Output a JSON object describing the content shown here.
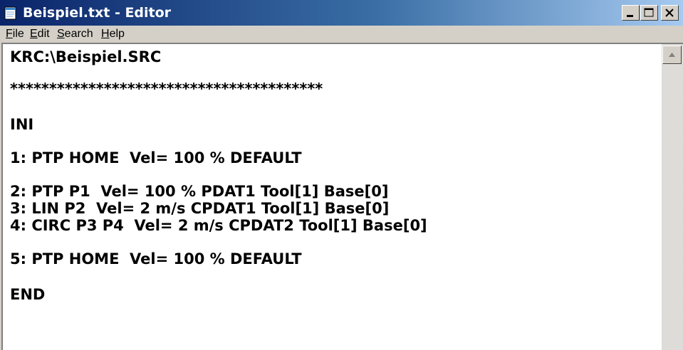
{
  "window": {
    "title": "Beispiel.txt - Editor",
    "app_icon": "notepad-icon",
    "caption_buttons": [
      "minimize-icon",
      "maximize-icon",
      "close-icon"
    ]
  },
  "menubar": {
    "items": [
      {
        "label_first": "F",
        "label_rest": "ile"
      },
      {
        "label_first": "E",
        "label_rest": "dit"
      },
      {
        "label_first": "S",
        "label_rest": "earch"
      },
      {
        "label_first": "H",
        "label_rest": "elp"
      }
    ]
  },
  "editor": {
    "lines": [
      "KRC:\\Beispiel.SRC",
      "****************************************",
      "INI",
      "1: PTP HOME  Vel= 100 % DEFAULT",
      "2: PTP P1  Vel= 100 % PDAT1 Tool[1] Base[0]",
      "3: LIN P2  Vel= 2 m/s CPDAT1 Tool[1] Base[0]",
      "4: CIRC P3 P4  Vel= 2 m/s CPDAT2 Tool[1] Base[0]",
      "5: PTP HOME  Vel= 100 % DEFAULT",
      "END"
    ]
  },
  "scrollbar": {
    "up_arrow_icon": "scroll-up-arrow-icon"
  },
  "colors": {
    "title_gradient_start": "#0a246a",
    "title_gradient_end": "#a6caf0",
    "chrome": "#d4d0c8",
    "editor_background": "#ffffff",
    "text": "#000000"
  }
}
